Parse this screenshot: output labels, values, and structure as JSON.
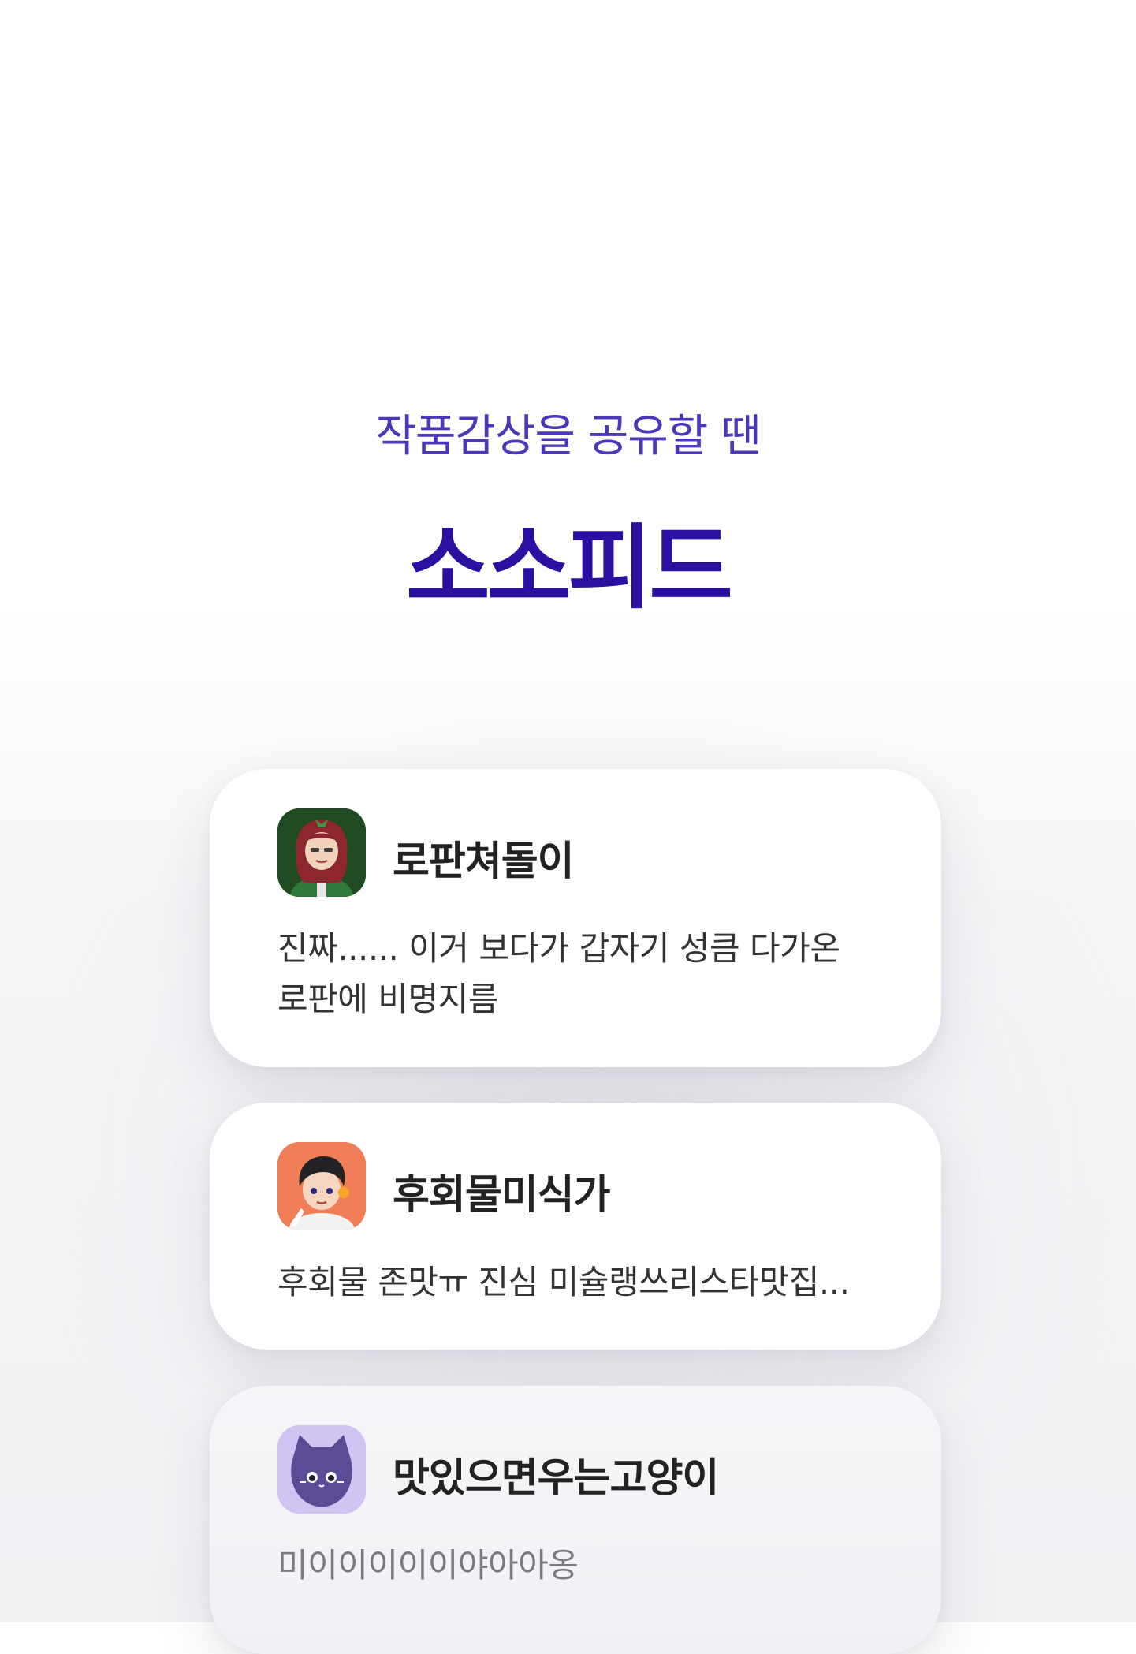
{
  "header": {
    "subtitle": "작품감상을 공유할 땐",
    "title": "소소피드"
  },
  "feed": [
    {
      "username": "로판쳐돌이",
      "avatar_icon": "red-haired-girl-avatar-icon",
      "avatar_bg": "#1f4a22",
      "text_line1": "진짜...... 이거 보다가 갑자기 성큼 다가온",
      "text_line2": "로판에 비명지름"
    },
    {
      "username": "후회물미식가",
      "avatar_icon": "dark-haired-boy-avatar-icon",
      "avatar_bg": "#f07e58",
      "text_line1": "후회물 존맛ㅠ 진심 미슐랭쓰리스타맛집..."
    },
    {
      "username": "맛있으면우는고양이",
      "avatar_icon": "purple-cat-avatar-icon",
      "avatar_bg": "#cfc4f2",
      "text_line1": "미이이이이이야아아옹"
    }
  ],
  "colors": {
    "accent": "#4b37b8",
    "title": "#2a0fa0"
  }
}
